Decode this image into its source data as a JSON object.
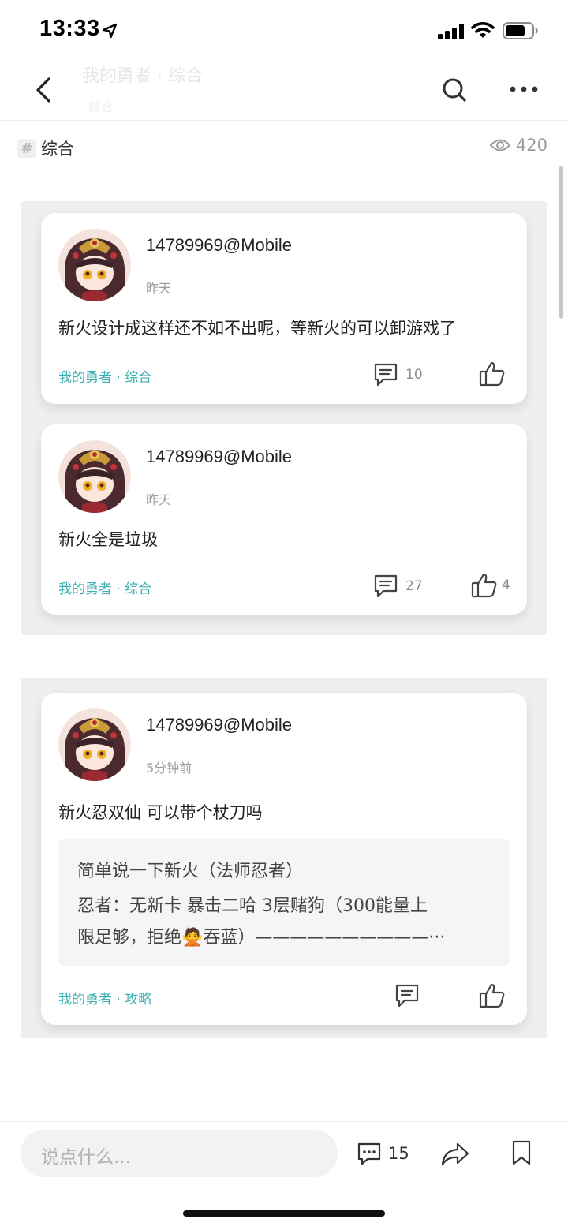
{
  "status_bar": {
    "time": "13:33"
  },
  "header": {
    "faded_title": "我的勇者 · 综合",
    "faded_subtitle": "综合"
  },
  "topic": {
    "label": "综合",
    "views": "420"
  },
  "groups": [
    {
      "posts": [
        {
          "username": "14789969@Mobile",
          "time": "昨天",
          "text": "新火设计成这样还不如不出呢，等新火的可以卸游戏了",
          "tag": "我的勇者 · 综合",
          "comments": "10",
          "likes": ""
        },
        {
          "username": "14789969@Mobile",
          "time": "昨天",
          "text": "新火全是垃圾",
          "tag": "我的勇者 · 综合",
          "comments": "27",
          "likes": "4"
        }
      ]
    },
    {
      "posts": [
        {
          "username": "14789969@Mobile",
          "time": "5分钟前",
          "text": "新火忍双仙 可以带个杖刀吗",
          "quote": {
            "line1": "简单说一下新火（法师忍者）",
            "line2": "忍者：无新卡 暴击二哈 3层赌狗（300能量上",
            "line3_before": "限足够，拒绝",
            "line3_emoji": "🙅",
            "line3_after": "吞蓝）——————————···"
          },
          "tag": "我的勇者 · 攻略",
          "comments": "",
          "likes": ""
        }
      ]
    }
  ],
  "bottom_bar": {
    "comment_placeholder": "说点什么...",
    "comment_count": "15"
  },
  "colors": {
    "accent_teal": "#3db0b3",
    "group_bg": "#efefef",
    "muted_text": "#9c9c9c"
  },
  "icons": [
    "location-arrow-icon",
    "signal-icon",
    "wifi-icon",
    "battery-icon",
    "back-icon",
    "search-icon",
    "more-icon",
    "hash-icon",
    "eye-icon",
    "comment-icon",
    "like-icon",
    "share-icon",
    "bookmark-icon"
  ]
}
